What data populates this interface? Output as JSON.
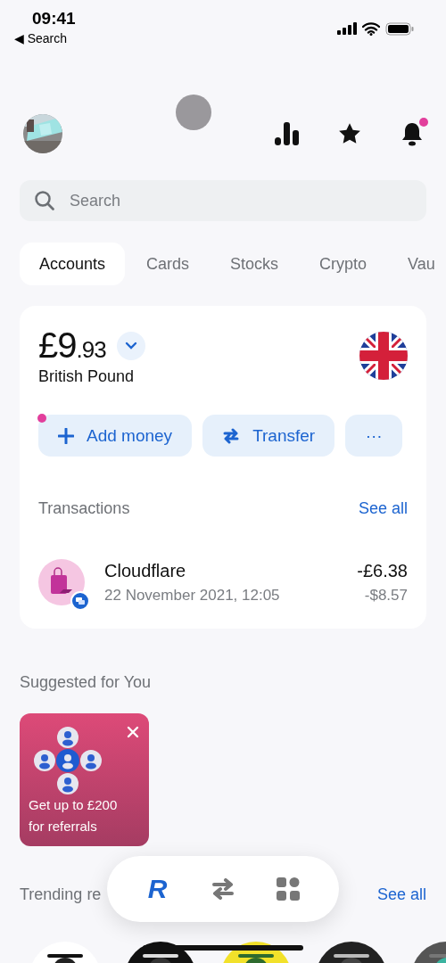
{
  "status_bar": {
    "time": "09:41",
    "back_label": "Search",
    "back_arrow": "◀"
  },
  "header": {
    "notification_badge": true
  },
  "search": {
    "placeholder": "Search"
  },
  "tabs": [
    {
      "label": "Accounts",
      "selected": true
    },
    {
      "label": "Cards",
      "selected": false
    },
    {
      "label": "Stocks",
      "selected": false
    },
    {
      "label": "Crypto",
      "selected": false
    },
    {
      "label": "Vau",
      "selected": false
    }
  ],
  "account": {
    "amount_major": "£9",
    "amount_minor": ".93",
    "currency": "British Pound",
    "actions": [
      {
        "kind": "add",
        "label": "Add money",
        "badge": true
      },
      {
        "kind": "transfer",
        "label": "Transfer",
        "badge": false
      },
      {
        "kind": "more",
        "label": "···",
        "badge": false
      }
    ]
  },
  "transactions": {
    "title": "Transactions",
    "see_all": "See all",
    "items": [
      {
        "name": "Cloudflare",
        "date": "22 November 2021, 12:05",
        "amount": "-£6.38",
        "secondary_amount": "-$8.57"
      }
    ]
  },
  "suggested": {
    "title": "Suggested for You",
    "cards": [
      {
        "text": "Get up to £200 for referrals"
      }
    ]
  },
  "trending": {
    "title": "Trending re",
    "see_all": "See all"
  },
  "nav": {
    "items": [
      {
        "kind": "logo",
        "label": "R",
        "selected": true
      },
      {
        "kind": "transfer",
        "selected": false
      },
      {
        "kind": "apps",
        "selected": false
      }
    ]
  }
}
